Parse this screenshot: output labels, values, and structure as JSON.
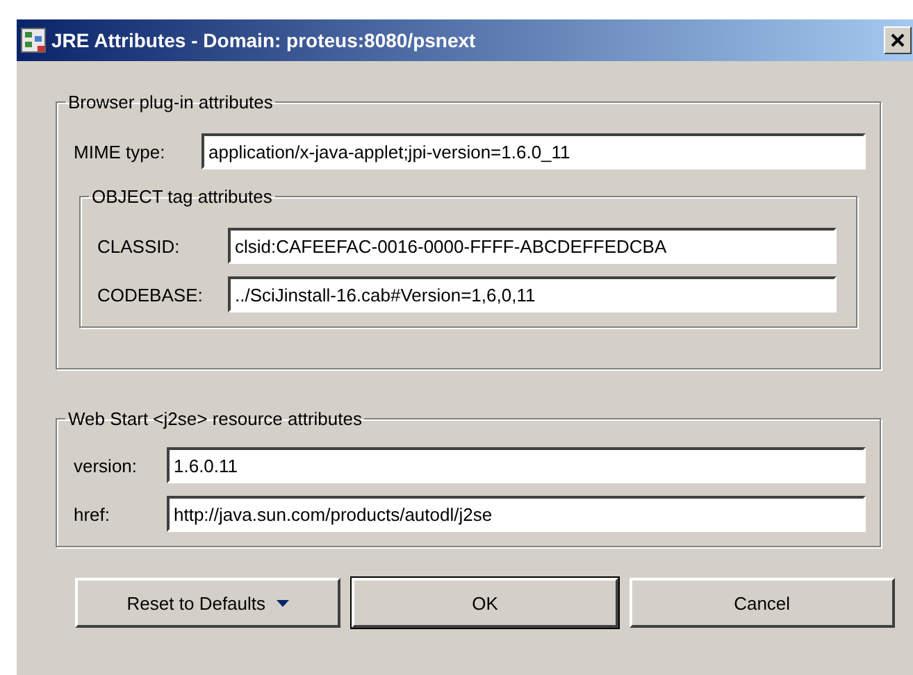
{
  "window": {
    "title": "JRE Attributes - Domain: proteus:8080/psnext"
  },
  "browser_group": {
    "title": "Browser plug-in attributes",
    "mime": {
      "label": "MIME type:",
      "value": "application/x-java-applet;jpi-version=1.6.0_11"
    },
    "object_group": {
      "title": "OBJECT tag attributes",
      "fields": [
        {
          "label": "CLASSID:",
          "value": "clsid:CAFEEFAC-0016-0000-FFFF-ABCDEFFEDCBA"
        },
        {
          "label": "CODEBASE:",
          "value": "../SciJinstall-16.cab#Version=1,6,0,11"
        }
      ]
    }
  },
  "webstart_group": {
    "title": "Web Start <j2se> resource attributes",
    "fields": [
      {
        "label": "version:",
        "value": "1.6.0.11"
      },
      {
        "label": "href:",
        "value": "http://java.sun.com/products/autodl/j2se"
      }
    ]
  },
  "buttons": [
    {
      "label": "Reset to Defaults",
      "kind": "menu",
      "selected": false
    },
    {
      "label": "OK",
      "kind": "plain",
      "selected": true
    },
    {
      "label": "Cancel",
      "kind": "plain",
      "selected": false
    }
  ]
}
